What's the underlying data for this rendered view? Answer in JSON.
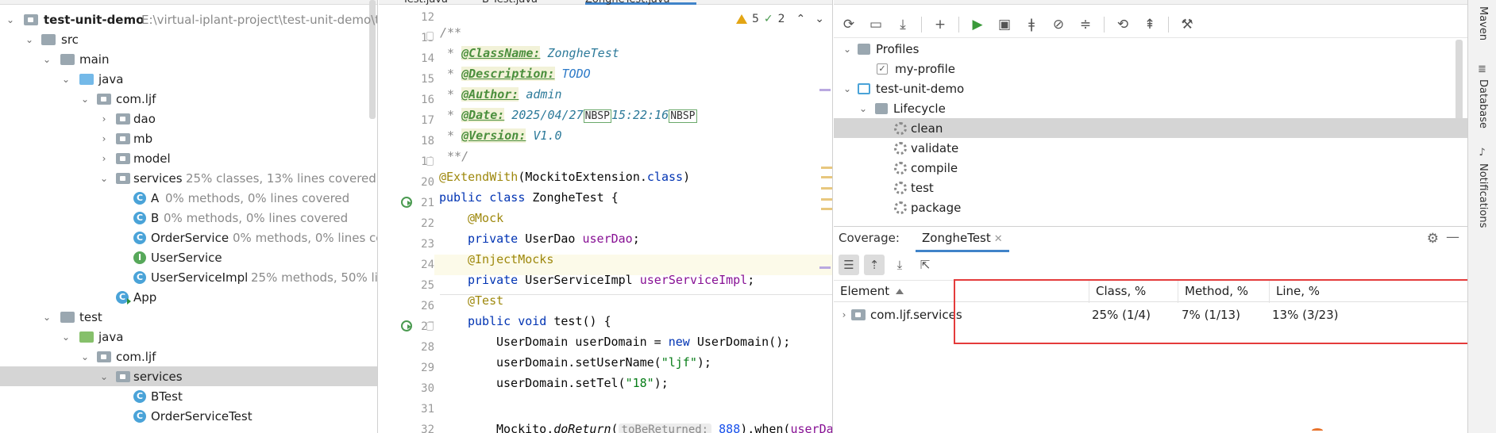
{
  "project": {
    "root_name": "test-unit-demo",
    "root_path": "E:\\virtual-iplant-project\\test-unit-demo\\t",
    "rows": [
      {
        "label": "src"
      },
      {
        "label": "main"
      },
      {
        "label": "java"
      },
      {
        "label": "com.ljf"
      },
      {
        "label": "dao"
      },
      {
        "label": "mb"
      },
      {
        "label": "model"
      },
      {
        "label": "services",
        "meta": "25% classes, 13% lines covered"
      },
      {
        "label": "A",
        "meta": "0% methods, 0% lines covered"
      },
      {
        "label": "B",
        "meta": "0% methods, 0% lines covered"
      },
      {
        "label": "OrderService",
        "meta": "0% methods, 0% lines cov"
      },
      {
        "label": "UserService"
      },
      {
        "label": "UserServiceImpl",
        "meta": "25% methods, 50% lin"
      },
      {
        "label": "App"
      },
      {
        "label": "test"
      },
      {
        "label": "java"
      },
      {
        "label": "com.ljf"
      },
      {
        "label": "services"
      },
      {
        "label": "BTest"
      },
      {
        "label": "OrderServiceTest"
      }
    ]
  },
  "editor": {
    "tabs": [
      "Test.java",
      "B Test.java",
      "ZongheTest.java"
    ],
    "inspections": {
      "warnings": "5",
      "ok": "2"
    },
    "line_numbers": [
      "12",
      "13",
      "14",
      "15",
      "16",
      "17",
      "18",
      "19",
      "20",
      "21",
      "22",
      "23",
      "24",
      "25",
      "26",
      "27",
      "28",
      "29",
      "30",
      "31",
      "32"
    ],
    "doc": {
      "open": "/**",
      "star": " * ",
      "tag_classname": "@ClassName:",
      "val_classname": " ZongheTest",
      "tag_description": "@Description:",
      "val_description": " TODO",
      "tag_author": "@Author:",
      "val_author": " admin",
      "tag_date": "@Date:",
      "val_date_1": " 2025/04/27",
      "nbsp": "NBSP",
      "val_date_2": "15:22:16",
      "tag_version": "@Version:",
      "val_version": " V1.0",
      "close": " **/"
    },
    "code": {
      "l20_ann": "@ExtendWith",
      "l20_rest": "(MockitoExtension.",
      "l20_kw": "class",
      "l20_end": ")",
      "l21_kw": "public class",
      "l21_rest": " ZongheTest {",
      "l22_ann": "@Mock",
      "l23_kw": "private",
      "l23_type": " UserDao ",
      "l23_field": "userDao",
      "l23_end": ";",
      "l24_ann": "@InjectMocks",
      "l25_kw": "private",
      "l25_type": " UserServiceImpl ",
      "l25_field": "userServiceImpl",
      "l25_end": ";",
      "l26_ann": "@Test",
      "l27_kw": "public void",
      "l27_rest": " test() {",
      "l28_a": "UserDomain userDomain = ",
      "l28_kw": "new",
      "l28_b": " UserDomain();",
      "l29_a": "userDomain.setUserName(",
      "l29_str": "\"ljf\"",
      "l29_b": ");",
      "l30_a": "userDomain.setTel(",
      "l30_str": "\"18\"",
      "l30_b": ");",
      "l32_a": "Mockito.",
      "l32_method": "doReturn",
      "l32_paren": "(",
      "l32_hint": "toBeReturned:",
      "l32_num": " 888",
      "l32_b": ").when(",
      "l32_field": "userDa"
    }
  },
  "maven": {
    "toolbar": [
      "reload-icon",
      "add-folder-icon",
      "download-icon",
      "plus-icon",
      "run-icon",
      "execute-goal-icon",
      "toggle-offline-icon",
      "skip-tests-icon",
      "collapse-icon",
      "analyze-icon",
      "show-deps-icon",
      "settings-wrench-icon"
    ],
    "profiles_label": "Profiles",
    "profile_item": "my-profile",
    "project_label": "test-unit-demo",
    "lifecycle_label": "Lifecycle",
    "goals": [
      "clean",
      "validate",
      "compile",
      "test",
      "package"
    ]
  },
  "coverage": {
    "title": "Coverage:",
    "tab": "ZongheTest",
    "columns": [
      "Element",
      "Class, %",
      "Method, %",
      "Line, %"
    ],
    "rows": [
      {
        "element": "com.ljf.services",
        "class_pct": "25% (1/4)",
        "method_pct": "7% (1/13)",
        "line_pct": "13% (3/23)"
      }
    ]
  },
  "side_strip": {
    "maven": "Maven",
    "database": "Database",
    "notifications": "Notifications"
  },
  "colors": {
    "accent": "#4083c9",
    "selection": "#d5d5d5",
    "highlight_box": "#e43b3b"
  }
}
